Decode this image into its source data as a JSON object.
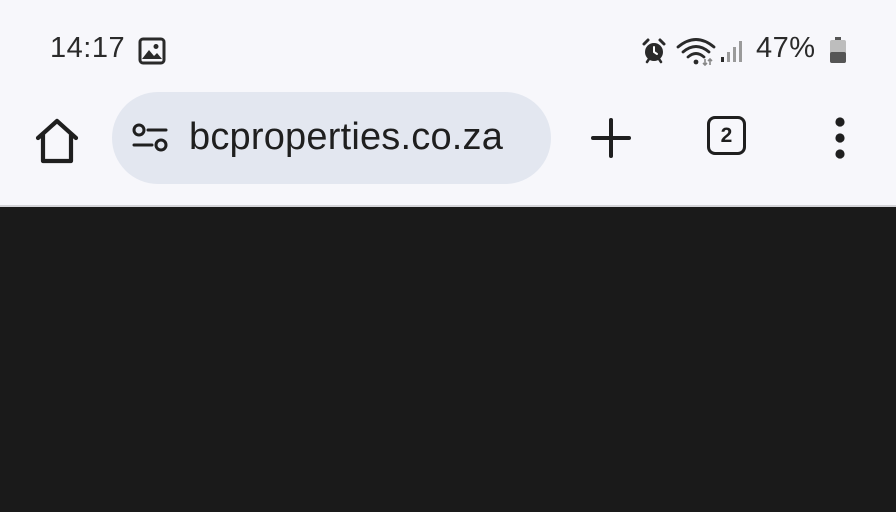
{
  "status_bar": {
    "time": "14:17",
    "battery_percent": "47%",
    "battery_level": 0.47,
    "icons": [
      "gallery-icon",
      "alarm-icon",
      "wifi-icon",
      "signal-icon",
      "battery-icon"
    ]
  },
  "toolbar": {
    "url": "bcproperties.co.za",
    "tab_count": "2",
    "icons": [
      "home-icon",
      "site-settings-icon",
      "plus-icon",
      "tab-switcher-icon",
      "more-vert-icon"
    ]
  },
  "colors": {
    "toolbar_bg": "#f7f7fb",
    "omnibox_bg": "#e3e7f0",
    "content_bg": "#1a1a1a"
  }
}
